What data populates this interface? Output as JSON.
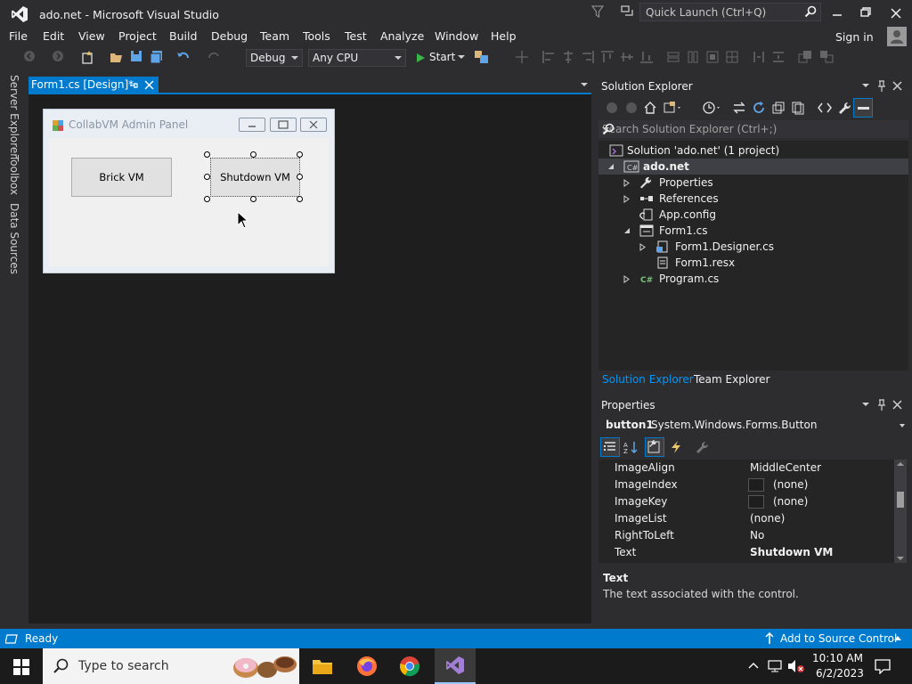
{
  "window": {
    "title": "ado.net - Microsoft Visual Studio"
  },
  "quick_launch": {
    "placeholder": "Quick Launch (Ctrl+Q)"
  },
  "menu": [
    "File",
    "Edit",
    "View",
    "Project",
    "Build",
    "Debug",
    "Team",
    "Tools",
    "Test",
    "Analyze",
    "Window",
    "Help"
  ],
  "sign_in": "Sign in",
  "toolbar": {
    "configuration": "Debug",
    "platform": "Any CPU",
    "start_label": "Start"
  },
  "side_tabs": [
    "Server Explorer",
    "Toolbox",
    "Data Sources"
  ],
  "document_tab": {
    "label": "Form1.cs [Design]*"
  },
  "designer_form": {
    "title": "CollabVM Admin Panel",
    "buttons": [
      {
        "label": "Brick VM"
      },
      {
        "label": "Shutdown VM"
      }
    ]
  },
  "solution_explorer": {
    "title": "Solution Explorer",
    "search_placeholder": "Search Solution Explorer (Ctrl+;)",
    "tree": [
      {
        "label": "Solution 'ado.net' (1 project)"
      },
      {
        "label": "ado.net"
      },
      {
        "label": "Properties"
      },
      {
        "label": "References"
      },
      {
        "label": "App.config"
      },
      {
        "label": "Form1.cs"
      },
      {
        "label": "Form1.Designer.cs"
      },
      {
        "label": "Form1.resx"
      },
      {
        "label": "Program.cs"
      }
    ],
    "tabs": [
      "Solution Explorer",
      "Team Explorer"
    ]
  },
  "properties": {
    "title": "Properties",
    "object_name": "button1",
    "object_type": "System.Windows.Forms.Button",
    "rows": [
      {
        "name": "ImageAlign",
        "value": "MiddleCenter"
      },
      {
        "name": "ImageIndex",
        "value": "(none)"
      },
      {
        "name": "ImageKey",
        "value": "(none)"
      },
      {
        "name": "ImageList",
        "value": "(none)"
      },
      {
        "name": "RightToLeft",
        "value": "No"
      },
      {
        "name": "Text",
        "value": "Shutdown VM"
      }
    ],
    "description_title": "Text",
    "description_text": "The text associated with the control."
  },
  "status_bar": {
    "status": "Ready",
    "source_control": "Add to Source Control"
  },
  "taskbar": {
    "search_placeholder": "Type to search",
    "time": "10:10 AM",
    "date": "6/2/2023"
  },
  "colors": {
    "accent": "#007acc",
    "background": "#2d2d30",
    "editor": "#1e1e1e"
  }
}
